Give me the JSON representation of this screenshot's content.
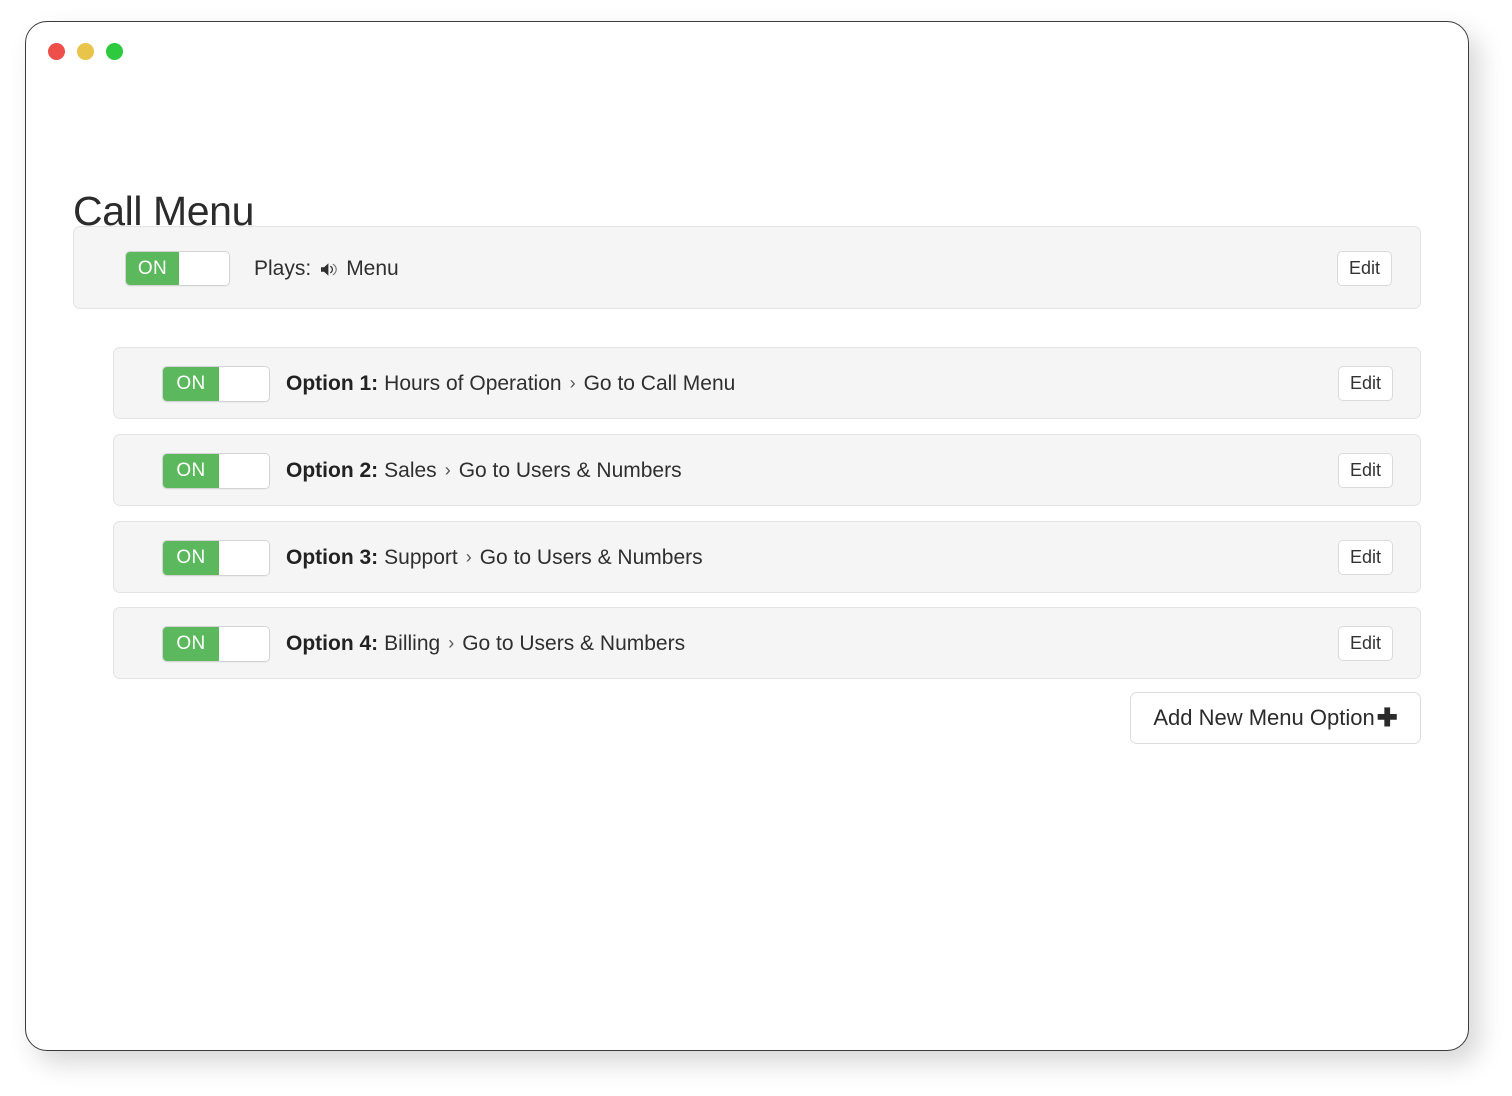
{
  "window": {
    "traffic_lights": [
      {
        "name": "close",
        "color": "#ee4f4b"
      },
      {
        "name": "minimize",
        "color": "#e9c44a"
      },
      {
        "name": "maximize",
        "color": "#2dc93e"
      }
    ]
  },
  "page": {
    "title": "Call Menu"
  },
  "header_row": {
    "toggle": {
      "state_label": "ON",
      "on": true,
      "on_color": "#5cb85c"
    },
    "plays_label": "Plays:",
    "speaker_icon": "speaker-wave-icon",
    "plays_value": "Menu",
    "edit_label": "Edit"
  },
  "options": [
    {
      "toggle": {
        "state_label": "ON",
        "on": true
      },
      "label": "Option 1:",
      "target": "Hours of Operation",
      "separator": "›",
      "destination": "Go to Call Menu",
      "edit_label": "Edit"
    },
    {
      "toggle": {
        "state_label": "ON",
        "on": true
      },
      "label": "Option 2:",
      "target": "Sales",
      "separator": "›",
      "destination": "Go to Users & Numbers",
      "edit_label": "Edit"
    },
    {
      "toggle": {
        "state_label": "ON",
        "on": true
      },
      "label": "Option 3:",
      "target": "Support",
      "separator": "›",
      "destination": "Go to Users & Numbers",
      "edit_label": "Edit"
    },
    {
      "toggle": {
        "state_label": "ON",
        "on": true
      },
      "label": "Option 4:",
      "target": "Billing",
      "separator": "›",
      "destination": "Go to Users & Numbers",
      "edit_label": "Edit"
    }
  ],
  "add_button": {
    "label": "Add New Menu Option",
    "icon": "plus-icon",
    "icon_glyph": "✚"
  }
}
